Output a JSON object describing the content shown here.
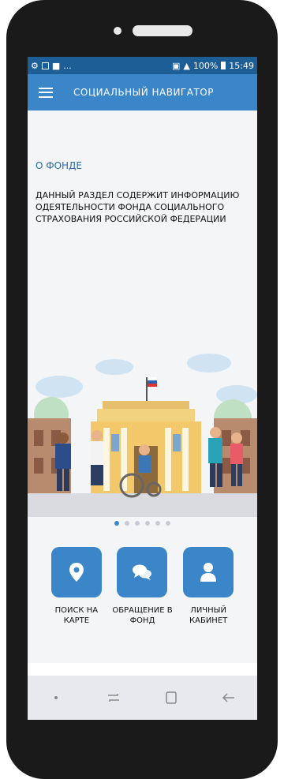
{
  "status_bar": {
    "battery": "100%",
    "time": "15:49",
    "notifications": "..."
  },
  "app_bar": {
    "title": "СОЦИАЛЬНЫЙ НАВИГАТОР",
    "menu_icon": "hamburger-icon"
  },
  "main": {
    "section_title": "О ФОНДЕ",
    "section_text": "ДАННЫЙ РАЗДЕЛ СОДЕРЖИТ ИНФОРМАЦИЮ ОДЕЯТЕЛЬНОСТИ ФОНДА СОЦИАЛЬНОГО СТРАХОВАНИЯ РОССИЙСКОЙ ФЕДЕРАЦИИ",
    "carousel": {
      "total": 6,
      "active_index": 0
    }
  },
  "tiles": [
    {
      "label": "ПОИСК НА КАРТЕ",
      "icon": "map-pin-icon"
    },
    {
      "label": "ОБРАЩЕНИЕ В ФОНД",
      "icon": "chat-bubbles-icon"
    },
    {
      "label": "ЛИЧНЫЙ КАБИНЕТ",
      "icon": "user-icon"
    }
  ],
  "colors": {
    "accent": "#3b86c9",
    "status_bar": "#1d5e96",
    "background": "#f4f5f7"
  }
}
